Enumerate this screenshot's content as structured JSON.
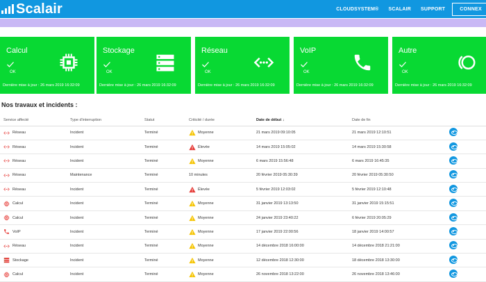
{
  "brand": "Scalair",
  "nav": {
    "items": [
      "CLOUDSYSTEM®",
      "SCALAIR",
      "SUPPORT"
    ],
    "connect": "CONNEX"
  },
  "colors": {
    "header": "#1197e0",
    "card": "#08d933",
    "banner": "#c9b8f5",
    "alert_red": "#e53935",
    "warn_yellow": "#f5c400"
  },
  "cards": [
    {
      "title": "Calcul",
      "status": "OK",
      "icon": "cpu-icon",
      "updated": "Dernière mise à jour : 26 mars 2019 16:32:09"
    },
    {
      "title": "Stockage",
      "status": "OK",
      "icon": "storage-icon",
      "updated": "Dernière mise à jour : 26 mars 2019 16:32:09"
    },
    {
      "title": "Réseau",
      "status": "OK",
      "icon": "network-icon",
      "updated": "Dernière mise à jour : 26 mars 2019 16:32:09"
    },
    {
      "title": "VoIP",
      "status": "OK",
      "icon": "phone-icon",
      "updated": "Dernière mise à jour : 26 mars 2019 16:32:09"
    },
    {
      "title": "Autre",
      "status": "OK",
      "icon": "other-icon",
      "updated": "Dernière mise à jour : 26 mars 2019 16:32:09"
    }
  ],
  "section_title": "Nos travaux et incidents :",
  "table": {
    "headers": [
      "Service affecté",
      "Type d'interruption",
      "Statut",
      "Criticité / durée",
      "Date de début",
      "Date de fin"
    ],
    "rows": [
      {
        "service": "Réseau",
        "service_icon": "network-icon",
        "type": "Incident",
        "status": "Terminé",
        "crit": "Moyenne",
        "crit_icon": "warning-icon",
        "start": "21 mars 2019 09:10:05",
        "end": "21 mars 2019 12:10:51"
      },
      {
        "service": "Réseau",
        "service_icon": "network-icon",
        "type": "Incident",
        "status": "Terminé",
        "crit": "Élevée",
        "crit_icon": "alert-icon",
        "start": "14 mars 2019 15:05:02",
        "end": "14 mars 2019 15:30:58"
      },
      {
        "service": "Réseau",
        "service_icon": "network-icon",
        "type": "Incident",
        "status": "Terminé",
        "crit": "Moyenne",
        "crit_icon": "warning-icon",
        "start": "6 mars 2019 15:56:48",
        "end": "6 mars 2019 16:45:35"
      },
      {
        "service": "Réseau",
        "service_icon": "network-icon",
        "type": "Maintenance",
        "status": "Terminé",
        "crit": "10 minutes",
        "crit_icon": "",
        "start": "20 février 2019 05:30:39",
        "end": "20 février 2019 05:30:50"
      },
      {
        "service": "Réseau",
        "service_icon": "network-icon",
        "type": "Incident",
        "status": "Terminé",
        "crit": "Élevée",
        "crit_icon": "alert-icon",
        "start": "5 février 2019 12:03:02",
        "end": "5 février 2019 12:10:48"
      },
      {
        "service": "Calcul",
        "service_icon": "cpu-icon",
        "type": "Incident",
        "status": "Terminé",
        "crit": "Moyenne",
        "crit_icon": "warning-icon",
        "start": "31 janvier 2019 13:13:50",
        "end": "31 janvier 2019 15:15:51"
      },
      {
        "service": "Calcul",
        "service_icon": "cpu-icon",
        "type": "Incident",
        "status": "Terminé",
        "crit": "Moyenne",
        "crit_icon": "warning-icon",
        "start": "24 janvier 2019 23:40:22",
        "end": "6 février 2019 20:05:29"
      },
      {
        "service": "VoIP",
        "service_icon": "phone-icon",
        "type": "Incident",
        "status": "Terminé",
        "crit": "Moyenne",
        "crit_icon": "warning-icon",
        "start": "17 janvier 2019 22:00:56",
        "end": "18 janvier 2019 14:00:57"
      },
      {
        "service": "Réseau",
        "service_icon": "network-icon",
        "type": "Incident",
        "status": "Terminé",
        "crit": "Moyenne",
        "crit_icon": "warning-icon",
        "start": "14 décembre 2018 16:00:00",
        "end": "14 décembre 2018 21:21:00"
      },
      {
        "service": "Stockage",
        "service_icon": "storage-icon",
        "type": "Incident",
        "status": "Terminé",
        "crit": "Moyenne",
        "crit_icon": "warning-icon",
        "start": "12 décembre 2018 12:30:00",
        "end": "18 décembre 2018 13:30:00"
      },
      {
        "service": "Calcul",
        "service_icon": "cpu-icon",
        "type": "Incident",
        "status": "Terminé",
        "crit": "Moyenne",
        "crit_icon": "warning-icon",
        "start": "26 novembre 2018 13:22:00",
        "end": "26 novembre 2018 13:46:00"
      }
    ]
  }
}
